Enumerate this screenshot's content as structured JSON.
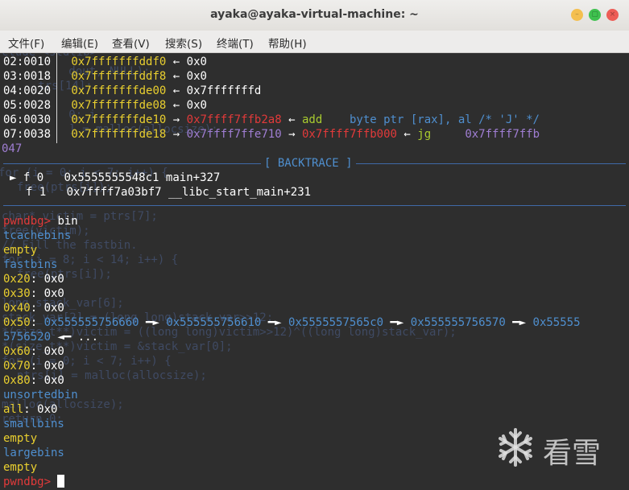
{
  "window": {
    "title": "ayaka@ayaka-virtual-machine: ~",
    "buttons": {
      "minimize": "–",
      "maximize": "▢",
      "close": "×"
    }
  },
  "menu": [
    "文件(F)",
    "编辑(E)",
    "查看(V)",
    "搜索(S)",
    "终端(T)",
    "帮助(H)"
  ],
  "stack": [
    {
      "idx": "02:0010",
      "addr": "0x7fffffffddf0",
      "arrow": "←",
      "val": "0x0"
    },
    {
      "idx": "03:0018",
      "addr": "0x7fffffffddf8",
      "arrow": "←",
      "val": "0x0"
    },
    {
      "idx": "04:0020",
      "addr": "0x7fffffffde00",
      "arrow": "←",
      "val": "0x7fffffffd"
    },
    {
      "idx": "05:0028",
      "addr": "0x7fffffffde08",
      "arrow": "←",
      "val": "0x0"
    },
    {
      "idx": "06:0030",
      "addr": "0x7fffffffde10",
      "arrow": "→",
      "val": "0x7ffff7ffb2a8",
      "arrow2": "←",
      "insn": "add",
      "ops": "byte ptr [rax], al /* 'J' */"
    },
    {
      "idx": "07:0038",
      "addr": "0x7fffffffde18",
      "arrow": "→",
      "val": "0x7ffff7ffe710",
      "arrow2": "→",
      "val2": "0x7ffff7ffb000",
      "arrow3": "←",
      "insn": "jg",
      "ops": "0x7ffff7ffb",
      "cont": "047"
    }
  ],
  "backtrace": {
    "label": "[ BACKTRACE ]",
    "frames": [
      {
        "marker": "►",
        "frame": "f 0",
        "addr": "0x5555555548c1",
        "sym": "main+327"
      },
      {
        "marker": "",
        "frame": "f 1",
        "addr": "0x7ffff7a03bf7",
        "sym": "__libc_start_main+231"
      }
    ]
  },
  "prompt": "pwndbg>",
  "command": "bin",
  "bins": {
    "tcache_label": "tcachebins",
    "tcache_val": "empty",
    "fast_label": "fastbins",
    "fast": [
      {
        "size": "0x20",
        "val": "0x0"
      },
      {
        "size": "0x30",
        "val": "0x0"
      },
      {
        "size": "0x40",
        "val": "0x0"
      },
      {
        "size": "0x50",
        "chain": [
          "0x555555756660",
          "0x555555756610",
          "0x5555557565c0",
          "0x555555756570",
          "0x55555"
        ],
        "cont": "5756520",
        "tail": "..."
      },
      {
        "size": "0x60",
        "val": "0x0"
      },
      {
        "size": "0x70",
        "val": "0x0"
      },
      {
        "size": "0x80",
        "val": "0x0"
      }
    ],
    "unsorted_label": "unsortedbin",
    "unsorted_all": "all",
    "unsorted_val": "0x0",
    "small_label": "smallbins",
    "small_val": "empty",
    "large_label": "largebins",
    "large_val": "empty"
  },
  "ghost_code": [
    "clude <stdlib>",
    "   dout, NULL);",
    "   trs[14];",
    "   0; i",
    "   ] = malloc(allocsize);",
    "for (i = 0; i < 7; i++) {",
    "  free(ptrs[i]);",
    "char* victim = ptrs[7];",
    "free(victim);",
    "// Fill the fastbin.",
    "for (i = 8; i < 14; i++) {",
    "  free(ptrs[i]);",
    "long stack_var[6];",
    "stack_var[2] = (long long)stack_var>>12;",
    "*(size_t**)victim = ((long long)victim>>12)^((long long)stack_var);",
    "*(size_t**)victim = &stack_var[0];",
    "for (i = 0; i < 7; i++) {",
    "  ptrs[i] = malloc(allocsize);",
    "malloc(allocsize);",
    "return 0;"
  ],
  "watermark": "看雪"
}
